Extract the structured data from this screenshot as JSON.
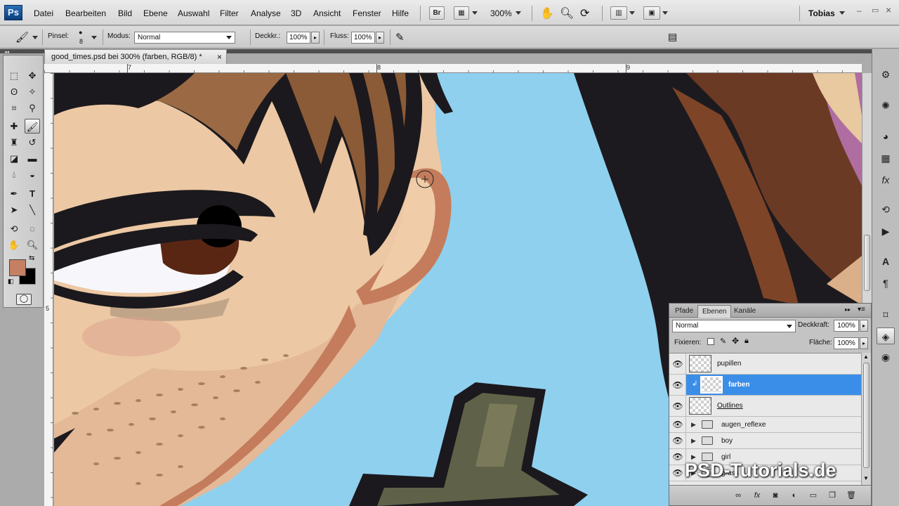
{
  "app": {
    "logo": "Ps",
    "user": "Tobias",
    "zoom": "300%",
    "bridge_label": "Br"
  },
  "menu": [
    "Datei",
    "Bearbeiten",
    "Bild",
    "Ebene",
    "Auswahl",
    "Filter",
    "Analyse",
    "3D",
    "Ansicht",
    "Fenster",
    "Hilfe"
  ],
  "options": {
    "brush_label": "Pinsel:",
    "brush_size": "8",
    "mode_label": "Modus:",
    "mode_value": "Normal",
    "opacity_label": "Deckkr.:",
    "opacity_value": "100%",
    "flow_label": "Fluss:",
    "flow_value": "100%"
  },
  "document": {
    "tab_title": "good_times.psd bei 300% (farben, RGB/8) *",
    "close": "×",
    "ruler_top": [
      "7",
      "8",
      "9"
    ],
    "ruler_left": [
      "5"
    ]
  },
  "colors": {
    "foreground": "#c58064",
    "background": "#000000",
    "selection": "#3b8ee8",
    "canvas_sky": "#8fd0ef"
  },
  "layers_panel": {
    "tabs": [
      "Pfade",
      "Ebenen",
      "Kanäle"
    ],
    "active_tab": "Ebenen",
    "blend_mode": "Normal",
    "opacity_label": "Deckkraft:",
    "opacity_value": "100%",
    "lock_label": "Fixieren:",
    "fill_label": "Fläche:",
    "fill_value": "100%",
    "layers": [
      {
        "name": "pupillen",
        "type": "layer",
        "visible": true,
        "selected": false
      },
      {
        "name": "farben",
        "type": "layer",
        "visible": true,
        "selected": true,
        "clipped": true
      },
      {
        "name": "Outlines",
        "type": "layer",
        "visible": true,
        "selected": false
      },
      {
        "name": "augen_reflexe",
        "type": "group",
        "visible": true,
        "selected": false
      },
      {
        "name": "boy",
        "type": "group",
        "visible": true,
        "selected": false
      },
      {
        "name": "girl",
        "type": "group",
        "visible": true,
        "selected": false
      },
      {
        "name": "grass",
        "type": "group",
        "visible": true,
        "selected": false
      }
    ]
  },
  "watermark": "PSD-Tutorials.de"
}
